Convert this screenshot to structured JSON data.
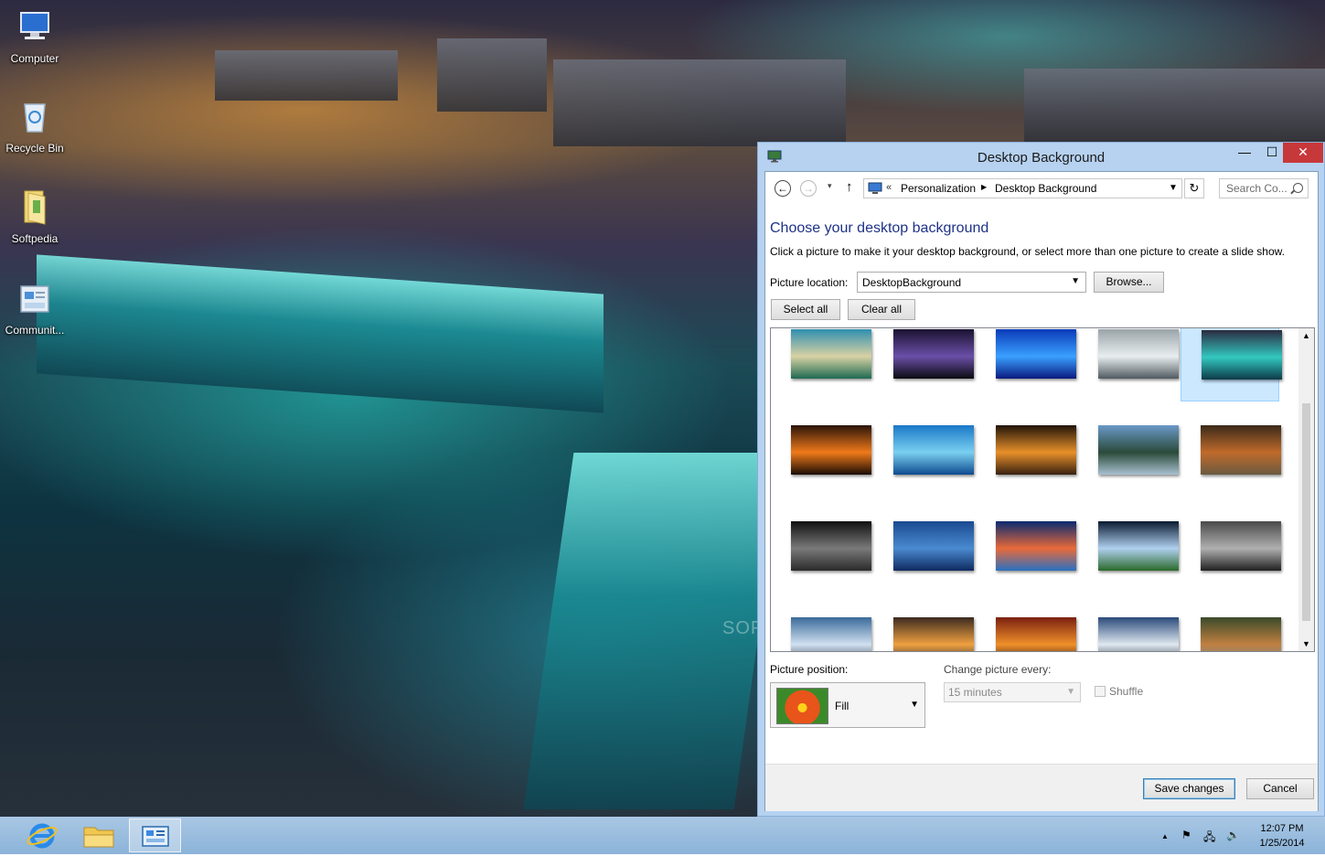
{
  "desktop": {
    "icons": [
      {
        "label": "Computer",
        "icon": "computer-icon"
      },
      {
        "label": "Recycle Bin",
        "icon": "recycle-bin-icon"
      },
      {
        "label": "Softpedia",
        "icon": "folder-icon"
      },
      {
        "label": "Communit...",
        "icon": "community-icon"
      }
    ],
    "watermark": "SOFTPEDIA"
  },
  "window": {
    "title": "Desktop Background",
    "controls": {
      "minimize": "—",
      "maximize": "☐",
      "close": "✕"
    },
    "nav": {
      "back": "←",
      "forward": "→",
      "recent": "▾",
      "up": "↑",
      "address_overflow": "«",
      "breadcrumb": [
        "Personalization",
        "Desktop Background"
      ],
      "refresh": "↻",
      "search_placeholder": "Search Co..."
    },
    "heading": "Choose your desktop background",
    "description": "Click a picture to make it your desktop background, or select more than one picture to create a slide show.",
    "picture_location": {
      "label": "Picture location:",
      "value": "DesktopBackground"
    },
    "browse_label": "Browse...",
    "select_all_label": "Select all",
    "clear_all_label": "Clear all",
    "thumbnails": [
      {
        "colors": [
          "#2e8fb0",
          "#d8d2a4",
          "#1e6a52"
        ],
        "selected": false
      },
      {
        "colors": [
          "#1a1230",
          "#6b4fa8",
          "#0a0a10"
        ],
        "selected": false
      },
      {
        "colors": [
          "#0a3ab8",
          "#3aa0ff",
          "#0a1a80"
        ],
        "selected": false
      },
      {
        "colors": [
          "#9aa4a8",
          "#e8eef0",
          "#505a60"
        ],
        "selected": false
      },
      {
        "colors": [
          "#2a2a40",
          "#33c8c0",
          "#0c3a48"
        ],
        "selected": true
      },
      {
        "colors": [
          "#2a1408",
          "#f07a1a",
          "#1a0c04"
        ],
        "selected": false
      },
      {
        "colors": [
          "#1a78c8",
          "#7ad0f0",
          "#0e4a90"
        ],
        "selected": false
      },
      {
        "colors": [
          "#20140a",
          "#e8902a",
          "#382010"
        ],
        "selected": false
      },
      {
        "colors": [
          "#6a98c8",
          "#2a4a3a",
          "#a8c0d0"
        ],
        "selected": false
      },
      {
        "colors": [
          "#3a2a1a",
          "#c06a2a",
          "#6a5a40"
        ],
        "selected": false
      },
      {
        "colors": [
          "#101010",
          "#7a7a7a",
          "#2a2a2a"
        ],
        "selected": false
      },
      {
        "colors": [
          "#1a4a90",
          "#4a8ad0",
          "#0e2a60"
        ],
        "selected": false
      },
      {
        "colors": [
          "#0a2a70",
          "#e86a3a",
          "#2a70c0"
        ],
        "selected": false
      },
      {
        "colors": [
          "#0a1a30",
          "#b0d0f0",
          "#2a6a2a"
        ],
        "selected": false
      },
      {
        "colors": [
          "#4a4a4a",
          "#b0b0b0",
          "#202020"
        ],
        "selected": false
      },
      {
        "colors": [
          "#3a6a9a",
          "#d0e0f0",
          "#2a3a4a"
        ],
        "selected": false
      },
      {
        "colors": [
          "#3a2a20",
          "#f0a040",
          "#102030"
        ],
        "selected": false
      },
      {
        "colors": [
          "#7a2010",
          "#f0902a",
          "#1a0a10"
        ],
        "selected": false
      },
      {
        "colors": [
          "#2a4a7a",
          "#e0e8f0",
          "#1a2a3a"
        ],
        "selected": false
      },
      {
        "colors": [
          "#3a4a2a",
          "#c08040",
          "#6a8aa0"
        ],
        "selected": false
      }
    ],
    "picture_position": {
      "label": "Picture position:",
      "value": "Fill"
    },
    "change_every": {
      "label": "Change picture every:",
      "value": "15 minutes"
    },
    "shuffle_label": "Shuffle",
    "save_label": "Save changes",
    "cancel_label": "Cancel"
  },
  "taskbar": {
    "apps": [
      "internet-explorer",
      "file-explorer",
      "control-panel"
    ],
    "tray": {
      "up_arrow": "▲",
      "flag": "⚑",
      "network": "🖧",
      "volume": "🔈"
    },
    "time": "12:07 PM",
    "date": "1/25/2014"
  },
  "colors": {
    "heading": "#1e3287",
    "close_button": "#c7383a",
    "selection": "#cce8ff",
    "taskbar": "#a9c7e4"
  }
}
